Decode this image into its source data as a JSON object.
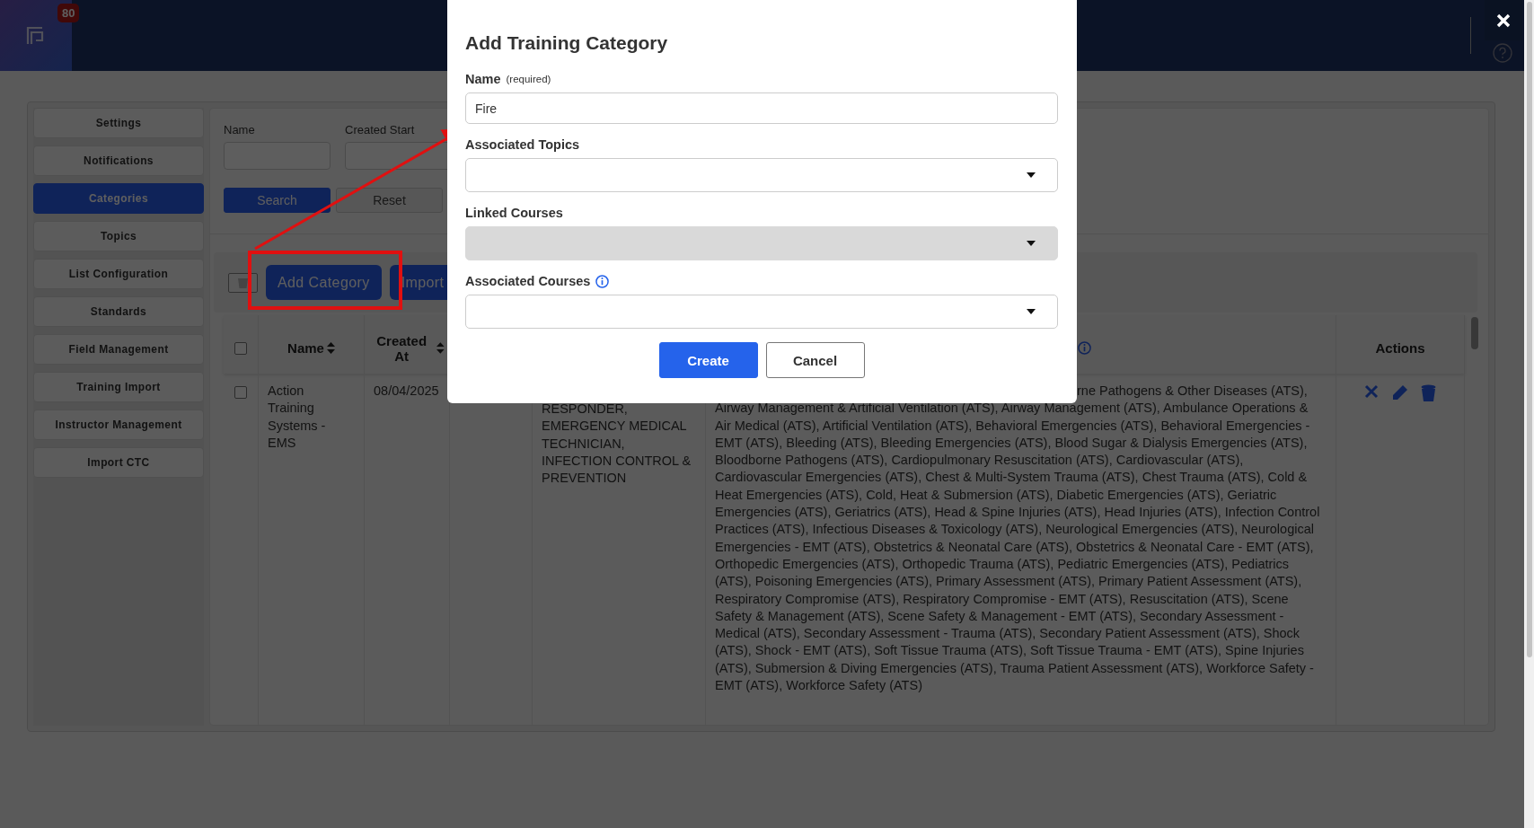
{
  "header": {
    "notification_count": "80"
  },
  "sidebar": {
    "items": [
      {
        "label": "Settings",
        "selected": false
      },
      {
        "label": "Notifications",
        "selected": false
      },
      {
        "label": "Categories",
        "selected": true
      },
      {
        "label": "Topics",
        "selected": false
      },
      {
        "label": "List Configuration",
        "selected": false
      },
      {
        "label": "Standards",
        "selected": false
      },
      {
        "label": "Field Management",
        "selected": false
      },
      {
        "label": "Training Import",
        "selected": false
      },
      {
        "label": "Instructor Management",
        "selected": false
      },
      {
        "label": "Import CTC",
        "selected": false
      }
    ]
  },
  "filters": {
    "fields": [
      {
        "label": "Name"
      },
      {
        "label": "Created Start"
      }
    ],
    "buttons": [
      {
        "label": "Search",
        "kind": "primary"
      },
      {
        "label": "Reset",
        "kind": "secondary"
      }
    ]
  },
  "toolbar": {
    "buttons": [
      {
        "label": "Add Category"
      },
      {
        "label": "Import"
      }
    ]
  },
  "table": {
    "select_all_checked": false,
    "columns": [
      {
        "kind": "select"
      },
      {
        "kind": "text",
        "label": "Name",
        "sortable": true
      },
      {
        "kind": "text",
        "label": "Created At",
        "sortable": true
      },
      {
        "kind": "blank"
      },
      {
        "kind": "blank"
      },
      {
        "kind": "info"
      },
      {
        "kind": "text",
        "label": "Actions",
        "sortable": false
      }
    ],
    "rows": [
      {
        "checked": false,
        "name": "Action Training Systems - EMS",
        "created_at": "08/04/2025",
        "column_5": "RESPONDER, EMERGENCY MEDICAL TECHNICIAN, INFECTION CONTROL & PREVENTION",
        "column_6": "rne Pathogens & Other Diseases (ATS), Airway Management & Artificial Ventilation (ATS), Airway Management (ATS), Ambulance Operations & Air Medical (ATS), Artificial Ventilation (ATS), Behavioral Emergencies (ATS), Behavioral Emergencies - EMT (ATS), Bleeding (ATS), Bleeding Emergencies (ATS), Blood Sugar & Dialysis Emergencies (ATS), Bloodborne Pathogens (ATS), Cardiopulmonary Resuscitation (ATS), Cardiovascular (ATS), Cardiovascular Emergencies (ATS), Chest & Multi-System Trauma (ATS), Chest Trauma (ATS), Cold & Heat Emergencies (ATS), Cold, Heat & Submersion (ATS), Diabetic Emergencies (ATS), Geriatric Emergencies (ATS), Geriatrics (ATS), Head & Spine Injuries (ATS), Head Injuries (ATS), Infection Control Practices (ATS), Infectious Diseases & Toxicology (ATS), Neurological Emergencies (ATS), Neurological Emergencies - EMT (ATS), Obstetrics & Neonatal Care (ATS), Obstetrics & Neonatal Care - EMT (ATS), Orthopedic Emergencies (ATS), Orthopedic Trauma (ATS), Pediatric Emergencies (ATS), Pediatrics (ATS), Poisoning Emergencies (ATS), Primary Assessment (ATS), Primary Patient Assessment (ATS), Respiratory Compromise (ATS), Respiratory Compromise - EMT (ATS), Resuscitation (ATS), Scene Safety & Management (ATS), Scene Safety & Management - EMT (ATS), Secondary Assessment - Medical (ATS), Secondary Assessment - Trauma (ATS), Secondary Patient Assessment (ATS), Shock (ATS), Shock - EMT (ATS), Soft Tissue Trauma (ATS), Soft Tissue Trauma - EMT (ATS), Spine Injuries (ATS), Submersion & Diving Emergencies (ATS), Trauma Patient Assessment (ATS), Workforce Safety - EMT (ATS), Workforce Safety (ATS)"
      }
    ]
  },
  "dialog": {
    "title": "Add Training Category",
    "fields": [
      {
        "kind": "text",
        "label": "Name",
        "hint": "(required)",
        "value": "Fire"
      },
      {
        "kind": "select",
        "label": "Associated Topics",
        "disabled": false
      },
      {
        "kind": "select",
        "label": "Linked Courses",
        "disabled": true
      },
      {
        "kind": "select",
        "label": "Associated Courses",
        "info": true,
        "disabled": false
      }
    ],
    "buttons": [
      {
        "label": "Create",
        "kind": "primary"
      },
      {
        "label": "Cancel",
        "kind": "secondary"
      }
    ]
  }
}
